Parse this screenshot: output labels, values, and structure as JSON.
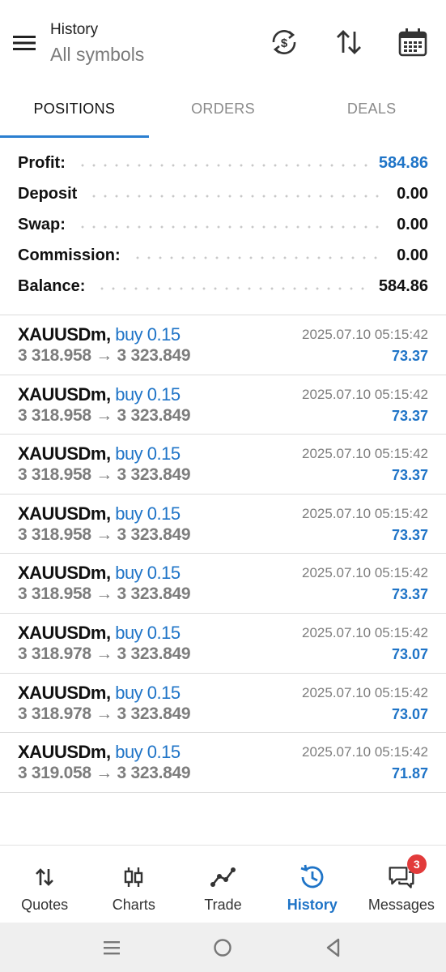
{
  "header": {
    "title": "History",
    "subtitle": "All symbols",
    "icons": [
      "menu-icon",
      "currency-exchange-icon",
      "sort-icon",
      "calendar-icon"
    ]
  },
  "tabs": [
    {
      "label": "POSITIONS",
      "active": true
    },
    {
      "label": "ORDERS",
      "active": false
    },
    {
      "label": "DEALS",
      "active": false
    }
  ],
  "summary": [
    {
      "label": "Profit:",
      "value": "584.86",
      "highlight": true
    },
    {
      "label": "Deposit",
      "value": "0.00",
      "highlight": false
    },
    {
      "label": "Swap:",
      "value": "0.00",
      "highlight": false
    },
    {
      "label": "Commission:",
      "value": "0.00",
      "highlight": false
    },
    {
      "label": "Balance:",
      "value": "584.86",
      "highlight": false
    }
  ],
  "positions": [
    {
      "symbol": "XAUUSDm,",
      "side": "buy 0.15",
      "open": "3 318.958",
      "arrow": "→",
      "close": "3 323.849",
      "time": "2025.07.10 05:15:42",
      "profit": "73.37"
    },
    {
      "symbol": "XAUUSDm,",
      "side": "buy 0.15",
      "open": "3 318.958",
      "arrow": "→",
      "close": "3 323.849",
      "time": "2025.07.10 05:15:42",
      "profit": "73.37"
    },
    {
      "symbol": "XAUUSDm,",
      "side": "buy 0.15",
      "open": "3 318.958",
      "arrow": "→",
      "close": "3 323.849",
      "time": "2025.07.10 05:15:42",
      "profit": "73.37"
    },
    {
      "symbol": "XAUUSDm,",
      "side": "buy 0.15",
      "open": "3 318.958",
      "arrow": "→",
      "close": "3 323.849",
      "time": "2025.07.10 05:15:42",
      "profit": "73.37"
    },
    {
      "symbol": "XAUUSDm,",
      "side": "buy 0.15",
      "open": "3 318.958",
      "arrow": "→",
      "close": "3 323.849",
      "time": "2025.07.10 05:15:42",
      "profit": "73.37"
    },
    {
      "symbol": "XAUUSDm,",
      "side": "buy 0.15",
      "open": "3 318.978",
      "arrow": "→",
      "close": "3 323.849",
      "time": "2025.07.10 05:15:42",
      "profit": "73.07"
    },
    {
      "symbol": "XAUUSDm,",
      "side": "buy 0.15",
      "open": "3 318.978",
      "arrow": "→",
      "close": "3 323.849",
      "time": "2025.07.10 05:15:42",
      "profit": "73.07"
    },
    {
      "symbol": "XAUUSDm,",
      "side": "buy 0.15",
      "open": "3 319.058",
      "arrow": "→",
      "close": "3 323.849",
      "time": "2025.07.10 05:15:42",
      "profit": "71.87"
    }
  ],
  "bottom_nav": [
    {
      "label": "Quotes",
      "icon": "quotes-icon",
      "active": false
    },
    {
      "label": "Charts",
      "icon": "charts-icon",
      "active": false
    },
    {
      "label": "Trade",
      "icon": "trade-icon",
      "active": false
    },
    {
      "label": "History",
      "icon": "history-icon",
      "active": true
    },
    {
      "label": "Messages",
      "icon": "messages-icon",
      "active": false,
      "badge": "3"
    }
  ],
  "colors": {
    "accent": "#1f74c7",
    "badge": "#e23b3b",
    "text": "#111111",
    "muted": "#7d7d7d"
  }
}
